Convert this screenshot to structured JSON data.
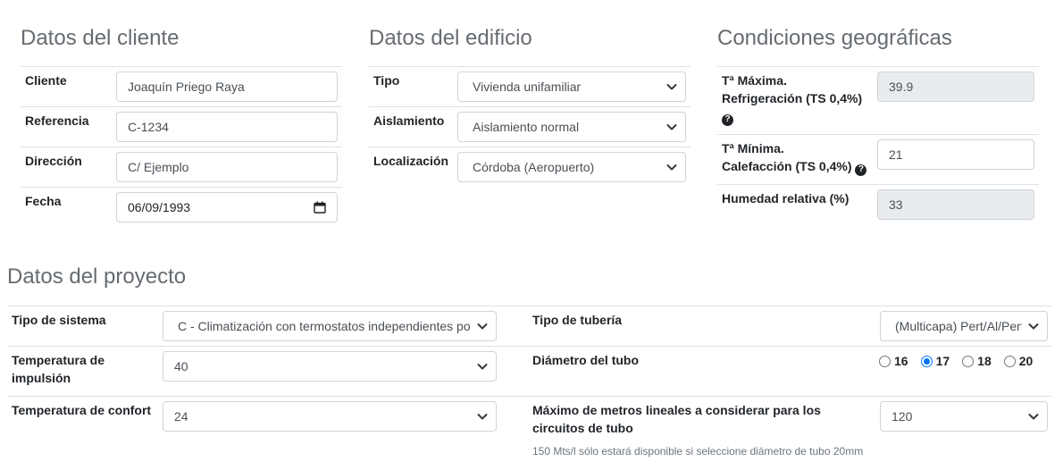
{
  "cliente": {
    "title": "Datos del cliente",
    "cliente_label": "Cliente",
    "cliente_value": "Joaquín Priego Raya",
    "referencia_label": "Referencia",
    "referencia_value": "C-1234",
    "direccion_label": "Dirección",
    "direccion_value": "C/ Ejemplo",
    "fecha_label": "Fecha",
    "fecha_value": "06/09/1993"
  },
  "edificio": {
    "title": "Datos del edificio",
    "tipo_label": "Tipo",
    "tipo_value": "Vivienda unifamiliar",
    "aislamiento_label": "Aislamiento",
    "aislamiento_value": "Aislamiento normal",
    "localizacion_label": "Localización",
    "localizacion_value": "Córdoba (Aeropuerto)"
  },
  "geo": {
    "title": "Condiciones geográficas",
    "tmax_label_1": "Tª Máxima.",
    "tmax_label_2": "Refrigeración (TS 0,4%)",
    "tmax_value": "39.9",
    "tmin_label_1": "Tª Mínima.",
    "tmin_label_2": "Calefacción (TS 0,4%)",
    "tmin_value": "21",
    "humedad_label": "Humedad relativa (%)",
    "humedad_value": "33",
    "help_glyph": "?"
  },
  "proyecto": {
    "title": "Datos del proyecto",
    "sistema_label": "Tipo de sistema",
    "sistema_value": "C - Climatización con termostatos independientes por",
    "impulsion_label_1": "Temperatura de",
    "impulsion_label_2": "impulsión",
    "impulsion_value": "40",
    "confort_label": "Temperatura de confort",
    "confort_value": "24",
    "tuberia_label": "Tipo de tubería",
    "tuberia_value": "(Multicapa) Pert/Al/Pert",
    "diametro_label": "Diámetro del tubo",
    "diametro_options": [
      "16",
      "17",
      "18",
      "20"
    ],
    "diametro_selected": "17",
    "metros_label_1": "Máximo de metros lineales a considerar para los",
    "metros_label_2": "circuitos de tubo",
    "metros_value": "120",
    "metros_help": "150 Mts/l sólo estará disponible si seleccione diámetro de tubo 20mm"
  },
  "icons": {
    "select": "chevron-down-icon",
    "date": "calendar-icon",
    "help": "question-circle-icon"
  }
}
